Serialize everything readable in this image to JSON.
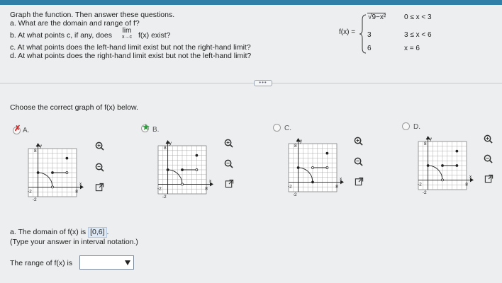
{
  "question": {
    "line1": "Graph the function. Then answer these questions.",
    "line_a": "a. What are the domain and range of f?",
    "line_b_before": "b. At what points c, if any, does",
    "lim": "lim",
    "lim_sub": "x→c",
    "line_b_after": "f(x) exist?",
    "line_c": "c. At what points does the left-hand limit exist but not the right-hand limit?",
    "line_d": "d. At what points does the right-hand limit exist but not the left-hand limit?"
  },
  "piecewise": {
    "label": "f(x) =",
    "pieces": [
      {
        "value": "√9−x²",
        "condition": "0 ≤ x < 3"
      },
      {
        "value": "3",
        "condition": "3 ≤ x < 6"
      },
      {
        "value": "6",
        "condition": "x = 6"
      }
    ]
  },
  "more_button": "•••",
  "choose_label": "Choose the correct graph of f(x) below.",
  "options": [
    {
      "label": "A.",
      "marker": "✗",
      "y_top": "8",
      "y_bottom": "-2",
      "x_left": "-2",
      "x_right": "8",
      "axis_x": "x",
      "axis_y": "Ay"
    },
    {
      "label": "B.",
      "marker": "★",
      "y_top": "8",
      "y_bottom": "-2",
      "x_left": "-2",
      "x_right": "8",
      "axis_x": "x",
      "axis_y": "Ay"
    },
    {
      "label": "C.",
      "marker": "",
      "y_top": "8",
      "y_bottom": "-2",
      "x_left": "-2",
      "x_right": "8",
      "axis_x": "x",
      "axis_y": "Ay"
    },
    {
      "label": "D.",
      "marker": "",
      "y_top": "8",
      "y_bottom": "-2",
      "x_left": "-2",
      "x_right": "8",
      "axis_x": "x",
      "axis_y": "Ay"
    }
  ],
  "answer": {
    "domain_prefix": "a. The domain of f(x) is",
    "domain_value": "[0,6]",
    "domain_suffix": ".",
    "hint": "(Type your answer in interval notation.)",
    "range_label": "The range of f(x) is"
  },
  "colors": {
    "accent": "#2f7fa8",
    "wrong": "#d22222",
    "correct": "#2a9a3a"
  }
}
